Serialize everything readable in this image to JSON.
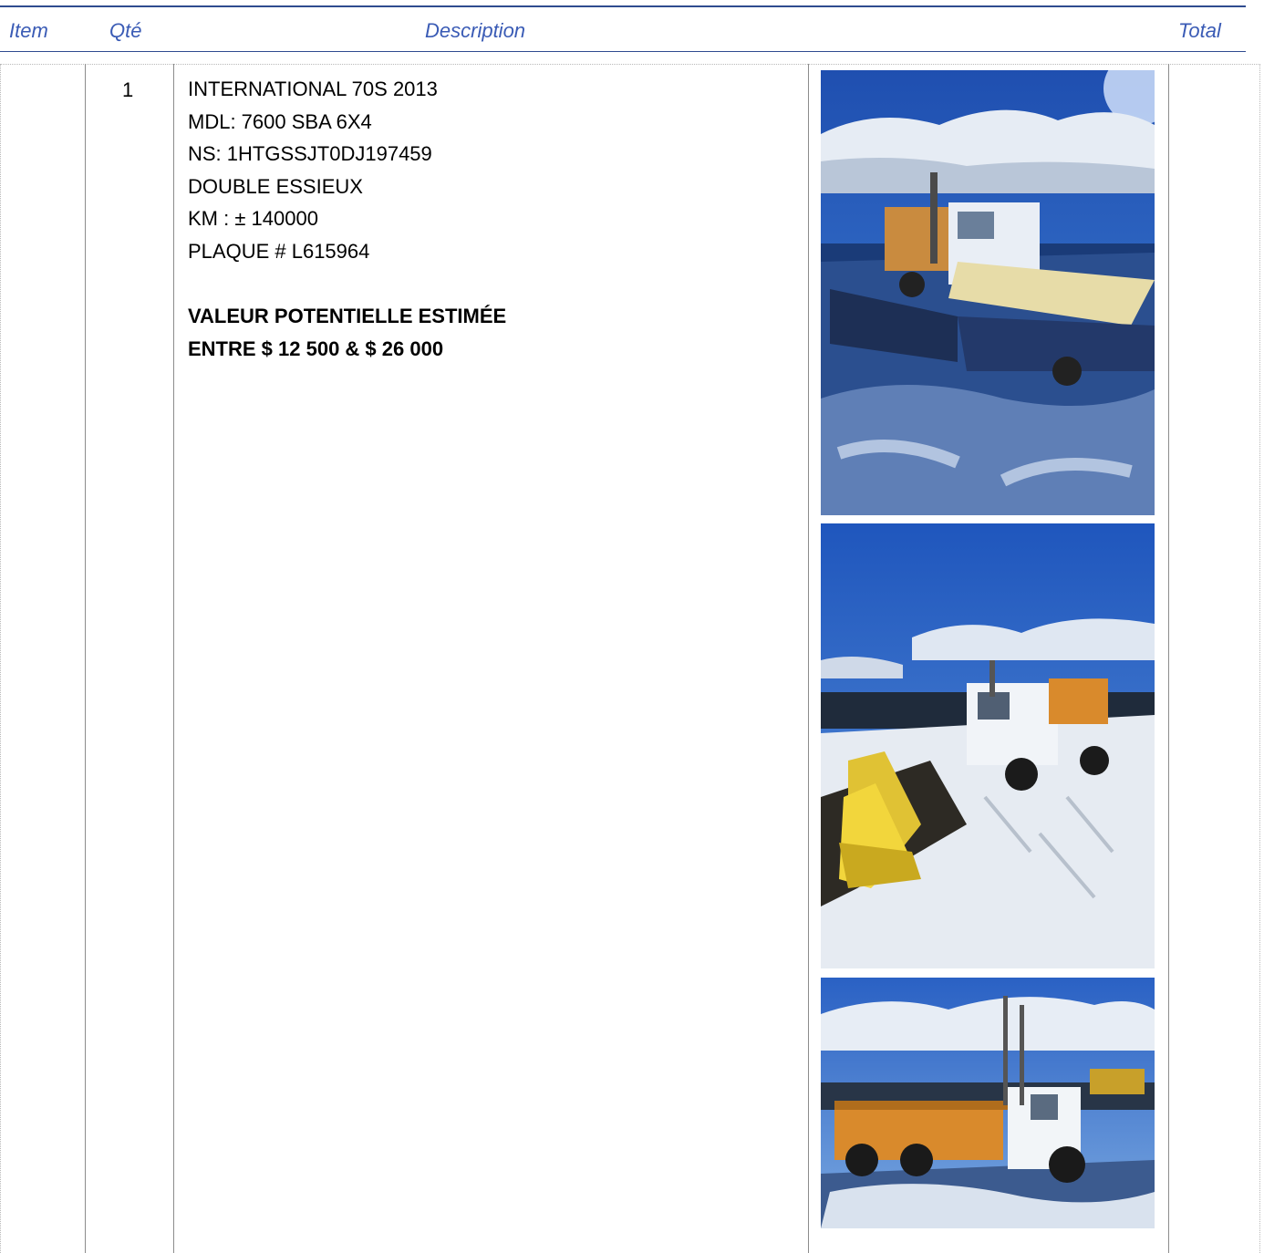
{
  "header": {
    "item": "Item",
    "qte": "Qté",
    "description": "Description",
    "total": "Total"
  },
  "row": {
    "qty": "1",
    "lines": [
      "INTERNATIONAL 70S 2013",
      "MDL: 7600 SBA 6X4",
      "NS: 1HTGSSJT0DJ197459",
      "DOUBLE ESSIEUX",
      "KM : ± 140000",
      "PLAQUE # L615964"
    ],
    "value_lines": [
      "VALEUR POTENTIELLE ESTIMÉE",
      "ENTRE $ 12 500 & $ 26 000"
    ]
  },
  "colors": {
    "header_text": "#3a5bb5",
    "header_rule": "#2f4b8f"
  }
}
